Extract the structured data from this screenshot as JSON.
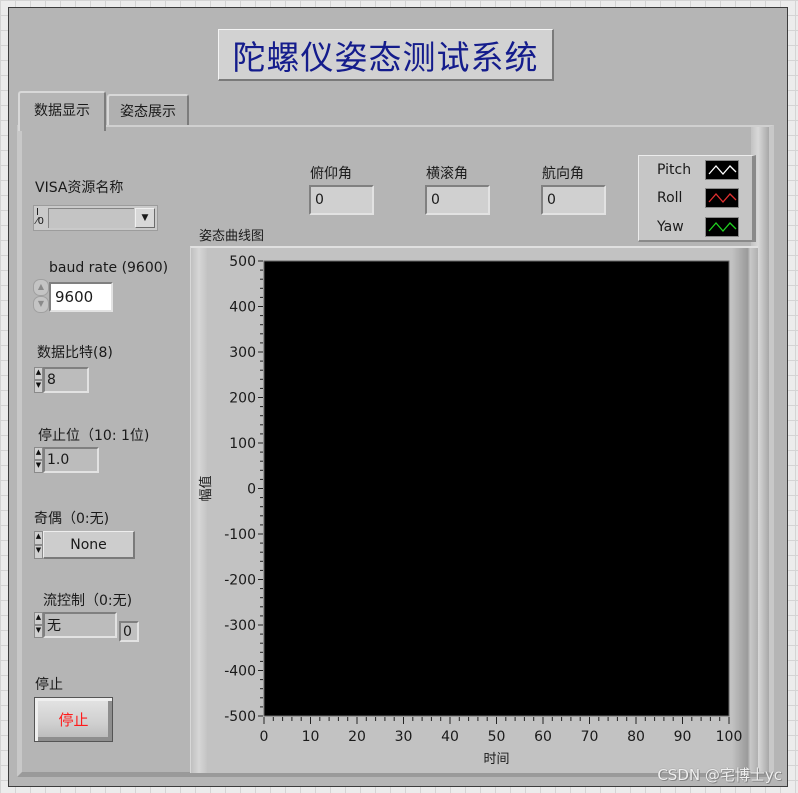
{
  "window": {
    "title": "陀螺仪姿态测试系统"
  },
  "tabs": [
    {
      "label": "数据显示",
      "active": true
    },
    {
      "label": "姿态展示",
      "active": false
    }
  ],
  "serial": {
    "visa_label": "VISA资源名称",
    "visa_io_glyph": "I/0",
    "visa_value": "",
    "baud_label": "baud rate (9600)",
    "baud_value": "9600",
    "databits_label": "数据比特(8)",
    "databits_value": "8",
    "stopbits_label": "停止位（10: 1位)",
    "stopbits_value": "1.0",
    "parity_label": "奇偶（0:无)",
    "parity_value": "None",
    "flow_label": "流控制（0:无)",
    "flow_value": "无",
    "flow_numeric": "0"
  },
  "stop": {
    "label": "停止",
    "button_label": "停止",
    "button_color": "#ff1a1a"
  },
  "angles": [
    {
      "label": "俯仰角",
      "value": "0"
    },
    {
      "label": "横滚角",
      "value": "0"
    },
    {
      "label": "航向角",
      "value": "0"
    }
  ],
  "legend": [
    {
      "name": "Pitch",
      "color": "#ffffff"
    },
    {
      "name": "Roll",
      "color": "#e03030"
    },
    {
      "name": "Yaw",
      "color": "#20d020"
    }
  ],
  "chart_data": {
    "type": "line",
    "title": "姿态曲线图",
    "xlabel": "时间",
    "ylabel": "幅值",
    "xlim": [
      0,
      100
    ],
    "ylim": [
      -500,
      500
    ],
    "x_ticks": [
      0,
      10,
      20,
      30,
      40,
      50,
      60,
      70,
      80,
      90,
      100
    ],
    "y_ticks": [
      500,
      400,
      300,
      200,
      100,
      0,
      -100,
      -200,
      -300,
      -400,
      -500
    ],
    "series": [
      {
        "name": "Pitch",
        "values": []
      },
      {
        "name": "Roll",
        "values": []
      },
      {
        "name": "Yaw",
        "values": []
      }
    ],
    "plot_background": "#000000",
    "grid": false,
    "legend_position": "top-right"
  },
  "watermark": "CSDN @宅博士yc"
}
